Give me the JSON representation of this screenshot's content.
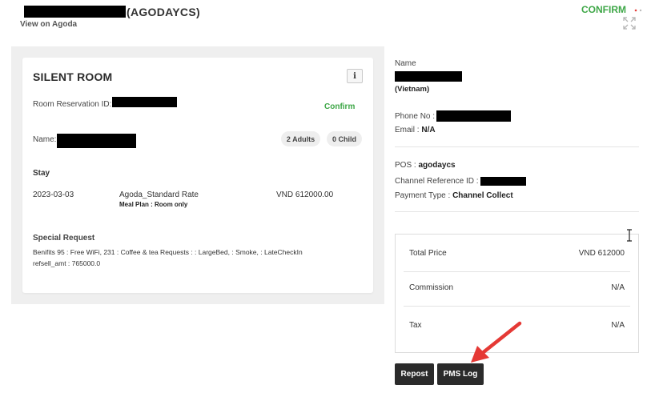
{
  "header": {
    "title_suffix": "(AGODAYCS)",
    "view_link": "View on Agoda",
    "status": "CONFIRM"
  },
  "room": {
    "title": "SILENT ROOM",
    "info_icon": "i",
    "reservation_id_label": "Room Reservation ID:",
    "status": "Confirm",
    "name_label": "Name:",
    "adults": "2 Adults",
    "children": "0 Child",
    "stay_label": "Stay",
    "stay": {
      "date": "2023-03-03",
      "rate": "Agoda_Standard Rate",
      "meal_plan": "Meal Plan : Room only",
      "price": "VND 612000.00"
    },
    "special_request_label": "Special Request",
    "special_request_line1": "Benifits 95 : Free WiFi, 231 : Coffee & tea Requests : : LargeBed, : Smoke, : LateCheckIn",
    "special_request_line2": "refsell_amt : 765000.0"
  },
  "guest": {
    "name_label": "Name",
    "country": "(Vietnam)",
    "phone_label": "Phone No :",
    "email_label": "Email : ",
    "email_value": "N/A"
  },
  "booking": {
    "pos_label": "POS : ",
    "pos_value": "agodaycs",
    "channel_ref_label": "Channel Reference ID :",
    "payment_label": "Payment Type : ",
    "payment_value": "Channel Collect"
  },
  "pricing": {
    "total_label": "Total Price",
    "total_value": "VND 612000",
    "commission_label": "Commission",
    "commission_value": "N/A",
    "tax_label": "Tax",
    "tax_value": "N/A"
  },
  "actions": {
    "repost": "Repost",
    "pms_log": "PMS Log"
  },
  "colors": {
    "confirm_green": "#3ea747",
    "button_dark": "#2b2b2b",
    "annotation_red": "#e53935",
    "panel_bg": "#efefef"
  }
}
